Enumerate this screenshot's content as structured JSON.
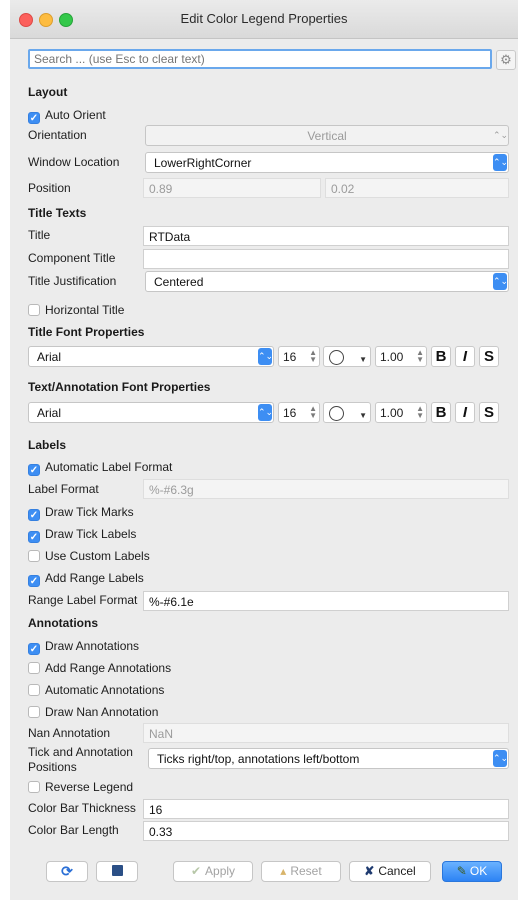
{
  "window": {
    "title": "Edit Color Legend Properties"
  },
  "search": {
    "placeholder": "Search ... (use Esc to clear text)"
  },
  "layout": {
    "section": "Layout",
    "auto_orient": "Auto Orient",
    "orientation_label": "Orientation",
    "orientation_value": "Vertical",
    "window_location_label": "Window Location",
    "window_location_value": "LowerRightCorner",
    "position_label": "Position",
    "position_x": "0.89",
    "position_y": "0.02"
  },
  "title_texts": {
    "section": "Title Texts",
    "title_label": "Title",
    "title_value": "RTData",
    "component_title_label": "Component Title",
    "component_title_value": "",
    "justification_label": "Title Justification",
    "justification_value": "Centered",
    "horizontal_title": "Horizontal Title"
  },
  "title_font": {
    "section": "Title Font Properties",
    "family": "Arial",
    "size": "16",
    "opacity": "1.00",
    "bold": "B",
    "italic": "I",
    "shadow": "S"
  },
  "text_font": {
    "section": "Text/Annotation Font Properties",
    "family": "Arial",
    "size": "16",
    "opacity": "1.00",
    "bold": "B",
    "italic": "I",
    "shadow": "S"
  },
  "labels": {
    "section": "Labels",
    "auto_format": "Automatic Label Format",
    "format_label": "Label Format",
    "format_value": "%-#6.3g",
    "draw_tick_marks": "Draw Tick Marks",
    "draw_tick_labels": "Draw Tick Labels",
    "use_custom_labels": "Use Custom Labels",
    "add_range_labels": "Add Range Labels",
    "range_format_label": "Range Label Format",
    "range_format_value": "%-#6.1e"
  },
  "annotations": {
    "section": "Annotations",
    "draw_annotations": "Draw Annotations",
    "add_range_annotations": "Add Range Annotations",
    "automatic_annotations": "Automatic Annotations",
    "draw_nan_annotation": "Draw Nan Annotation",
    "nan_label": "Nan Annotation",
    "nan_value": "NaN",
    "positions_label_1": "Tick and Annotation",
    "positions_label_2": "Positions",
    "positions_value": "Ticks right/top, annotations left/bottom",
    "reverse_legend": "Reverse Legend",
    "thickness_label": "Color Bar Thickness",
    "thickness_value": "16",
    "length_label": "Color Bar Length",
    "length_value": "0.33"
  },
  "footer": {
    "apply": "Apply",
    "reset": "Reset",
    "cancel": "Cancel",
    "ok": "OK"
  },
  "colors": {
    "accent": "#3d8ef3",
    "window_bg": "#ececec"
  }
}
